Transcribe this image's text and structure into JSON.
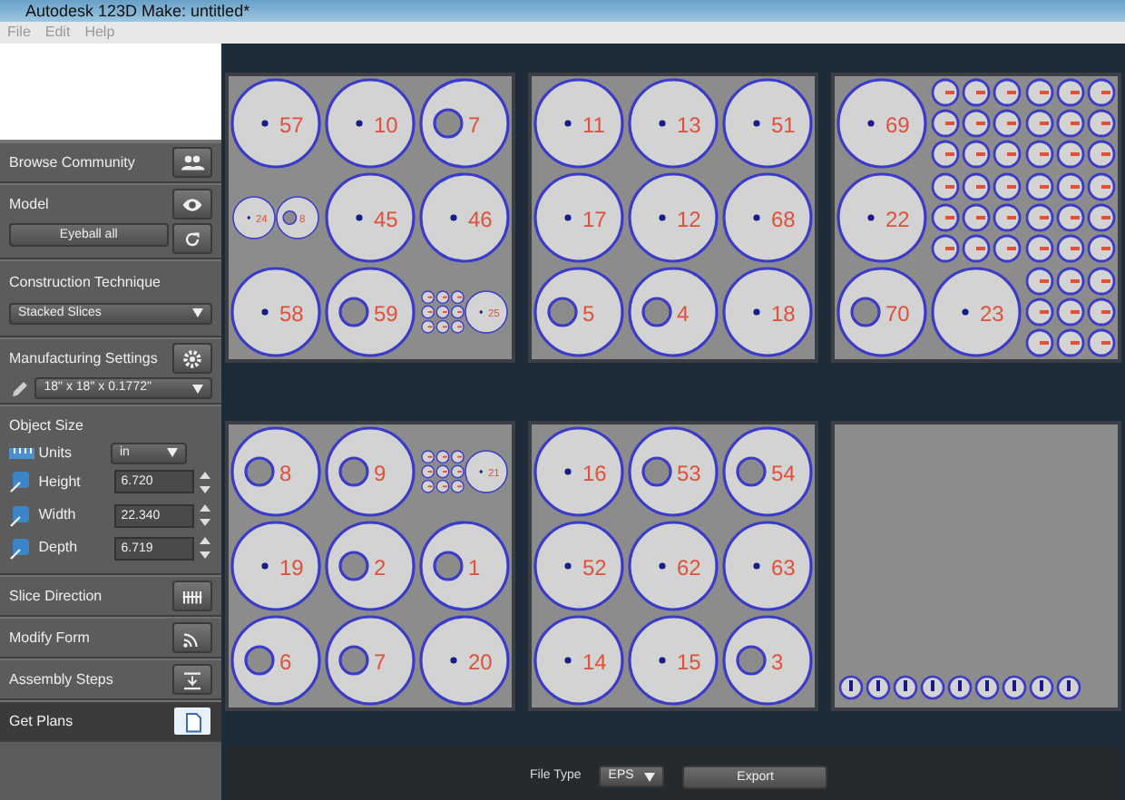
{
  "window": {
    "title": "Autodesk 123D Make: untitled*"
  },
  "menu": [
    "File",
    "Edit",
    "Help"
  ],
  "sidebar": [
    {
      "kind": "header",
      "title": "Browse Community"
    },
    {
      "kind": "model",
      "title": "Model",
      "button": "Eyeball all"
    },
    {
      "kind": "select",
      "title": "Construction Technique",
      "value": "Stacked Slices"
    },
    {
      "kind": "settings",
      "title": "Manufacturing Settings",
      "value": "18\" x 18\" x 0.1772\""
    },
    {
      "kind": "size",
      "title": "Object Size",
      "units_label": "Units",
      "units": "in",
      "fields": [
        {
          "label": "Height",
          "value": "6.720"
        },
        {
          "label": "Width",
          "value": "22.340"
        },
        {
          "label": "Depth",
          "value": "6.719"
        }
      ]
    },
    {
      "kind": "header",
      "title": "Slice Direction",
      "selected": false
    },
    {
      "kind": "header",
      "title": "Modify Form",
      "selected": false
    },
    {
      "kind": "header",
      "title": "Assembly Steps",
      "selected": false
    },
    {
      "kind": "header",
      "title": "Get Plans",
      "selected": true
    }
  ],
  "sheets": [
    {
      "kind": "parts",
      "cells": [
        [
          {
            "kind": "disk",
            "label": "57"
          }
        ],
        [
          {
            "kind": "disk",
            "label": "10"
          }
        ],
        [
          {
            "kind": "ring",
            "label": "7"
          }
        ],
        [
          {
            "kind": "disk",
            "label": "24"
          },
          {
            "kind": "ring",
            "label": "8"
          }
        ],
        [
          {
            "kind": "disk",
            "label": "45"
          }
        ],
        [
          {
            "kind": "disk",
            "label": "46"
          }
        ],
        [
          {
            "kind": "disk",
            "label": "58"
          }
        ],
        [
          {
            "kind": "ring",
            "label": "59"
          }
        ],
        [
          {
            "kind": "smalls"
          },
          {
            "kind": "disk",
            "label": "25"
          }
        ]
      ]
    },
    {
      "kind": "parts",
      "cells": [
        [
          {
            "kind": "disk",
            "label": "11"
          }
        ],
        [
          {
            "kind": "disk",
            "label": "13"
          }
        ],
        [
          {
            "kind": "disk",
            "label": "51"
          }
        ],
        [
          {
            "kind": "disk",
            "label": "17"
          }
        ],
        [
          {
            "kind": "disk",
            "label": "12"
          }
        ],
        [
          {
            "kind": "disk",
            "label": "68"
          }
        ],
        [
          {
            "kind": "ring",
            "label": "5"
          }
        ],
        [
          {
            "kind": "ring",
            "label": "4"
          }
        ],
        [
          {
            "kind": "disk",
            "label": "18"
          }
        ]
      ]
    },
    {
      "kind": "parts",
      "cells": [
        [
          {
            "kind": "disk",
            "label": "69"
          }
        ],
        [
          {
            "kind": "smalls"
          }
        ],
        [
          {
            "kind": "smalls"
          }
        ],
        [
          {
            "kind": "disk",
            "label": "22"
          }
        ],
        [
          {
            "kind": "smalls"
          }
        ],
        [
          {
            "kind": "smalls"
          }
        ],
        [
          {
            "kind": "ring",
            "label": "70"
          }
        ],
        [
          {
            "kind": "disk",
            "label": "23"
          }
        ],
        [
          {
            "kind": "smalls"
          }
        ]
      ]
    },
    {
      "kind": "parts",
      "cells": [
        [
          {
            "kind": "ring",
            "label": "8"
          }
        ],
        [
          {
            "kind": "ring",
            "label": "9"
          }
        ],
        [
          {
            "kind": "smalls"
          },
          {
            "kind": "disk",
            "label": "21"
          }
        ],
        [
          {
            "kind": "disk",
            "label": "19"
          }
        ],
        [
          {
            "kind": "ring",
            "label": "2"
          }
        ],
        [
          {
            "kind": "ring",
            "label": "1"
          }
        ],
        [
          {
            "kind": "ring",
            "label": "6"
          }
        ],
        [
          {
            "kind": "ring",
            "label": "7"
          }
        ],
        [
          {
            "kind": "disk",
            "label": "20"
          }
        ]
      ]
    },
    {
      "kind": "parts",
      "cells": [
        [
          {
            "kind": "disk",
            "label": "16"
          }
        ],
        [
          {
            "kind": "ring",
            "label": "53"
          }
        ],
        [
          {
            "kind": "ring",
            "label": "54"
          }
        ],
        [
          {
            "kind": "disk",
            "label": "52"
          }
        ],
        [
          {
            "kind": "disk",
            "label": "62"
          }
        ],
        [
          {
            "kind": "disk",
            "label": "63"
          }
        ],
        [
          {
            "kind": "disk",
            "label": "14"
          }
        ],
        [
          {
            "kind": "disk",
            "label": "15"
          }
        ],
        [
          {
            "kind": "ring",
            "label": "3"
          }
        ]
      ]
    },
    {
      "kind": "strip"
    }
  ],
  "export": {
    "file_type_label": "File Type",
    "file_type": "EPS",
    "button": "Export"
  }
}
